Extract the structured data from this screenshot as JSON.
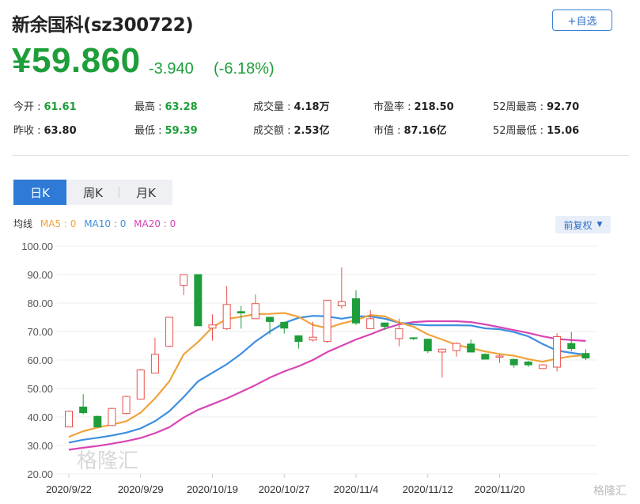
{
  "header": {
    "title": "新余国科(sz300722)",
    "watch_label": "+自选",
    "price": "¥59.860",
    "change": "-3.940",
    "change_pct": "(-6.18%)"
  },
  "stats": [
    {
      "label": "今开 :",
      "value": "61.61",
      "color": "green"
    },
    {
      "label": "最高 :",
      "value": "63.28",
      "color": "green"
    },
    {
      "label": "成交量 :",
      "value": "4.18万",
      "color": "dark"
    },
    {
      "label": "市盈率 :",
      "value": "218.50",
      "color": "dark"
    },
    {
      "label": "52周最高 :",
      "value": "92.70",
      "color": "dark"
    },
    {
      "label": "昨收 :",
      "value": "63.80",
      "color": "dark"
    },
    {
      "label": "最低 :",
      "value": "59.39",
      "color": "green"
    },
    {
      "label": "成交额 :",
      "value": "2.53亿",
      "color": "dark"
    },
    {
      "label": "市值 :",
      "value": "87.16亿",
      "color": "dark"
    },
    {
      "label": "52周最低 :",
      "value": "15.06",
      "color": "dark"
    }
  ],
  "tabs": [
    "日K",
    "周K",
    "月K"
  ],
  "ma_legend": {
    "prefix": "均线",
    "ma5": "MA5 : 0",
    "ma10": "MA10 : 0",
    "ma20": "MA20 : 0"
  },
  "adjust_label": "前复权",
  "watermark": {
    "center": "格隆汇",
    "corner": "格隆汇"
  },
  "colors": {
    "up": "#e8524d",
    "down": "#1e9e3a",
    "ma5": "#f0a33c",
    "ma10": "#3d8fe0",
    "ma20": "#d944b4",
    "accent": "#2f7ad6"
  },
  "chart_data": {
    "type": "candlestick",
    "ylim": [
      20,
      100
    ],
    "y_ticks": [
      "100.00",
      "90.00",
      "80.00",
      "70.00",
      "60.00",
      "50.00",
      "40.00",
      "30.00",
      "20.00"
    ],
    "x_tick_labels": [
      "2020/9/22",
      "2020/9/29",
      "2020/10/19",
      "2020/10/27",
      "2020/11/4",
      "2020/11/12",
      "2020/11/20"
    ],
    "x_tick_index": [
      0,
      5,
      10,
      15,
      20,
      25,
      30
    ],
    "candles": [
      {
        "o": 36.5,
        "h": 42.2,
        "l": 36.5,
        "c": 42.0
      },
      {
        "o": 43.5,
        "h": 48.0,
        "l": 41.0,
        "c": 41.5
      },
      {
        "o": 40.2,
        "h": 40.5,
        "l": 36.3,
        "c": 36.5
      },
      {
        "o": 37.0,
        "h": 43.2,
        "l": 36.8,
        "c": 43.0
      },
      {
        "o": 41.2,
        "h": 47.5,
        "l": 41.0,
        "c": 47.2
      },
      {
        "o": 46.3,
        "h": 56.8,
        "l": 46.2,
        "c": 56.5
      },
      {
        "o": 55.4,
        "h": 67.8,
        "l": 55.3,
        "c": 62.0
      },
      {
        "o": 64.8,
        "h": 75.0,
        "l": 64.5,
        "c": 75.0
      },
      {
        "o": 86.2,
        "h": 90.2,
        "l": 82.8,
        "c": 90.0
      },
      {
        "o": 90.0,
        "h": 90.0,
        "l": 72.0,
        "c": 72.0
      },
      {
        "o": 71.2,
        "h": 76.0,
        "l": 66.8,
        "c": 72.3
      },
      {
        "o": 71.0,
        "h": 86.0,
        "l": 70.5,
        "c": 79.5
      },
      {
        "o": 77.0,
        "h": 79.0,
        "l": 71.0,
        "c": 76.5
      },
      {
        "o": 74.5,
        "h": 83.0,
        "l": 74.3,
        "c": 79.8
      },
      {
        "o": 75.0,
        "h": 75.2,
        "l": 69.0,
        "c": 73.5
      },
      {
        "o": 73.2,
        "h": 73.5,
        "l": 69.3,
        "c": 71.2
      },
      {
        "o": 68.5,
        "h": 68.7,
        "l": 64.0,
        "c": 66.5
      },
      {
        "o": 67.0,
        "h": 73.5,
        "l": 66.5,
        "c": 68.0
      },
      {
        "o": 66.5,
        "h": 81.0,
        "l": 66.0,
        "c": 81.0
      },
      {
        "o": 79.0,
        "h": 92.5,
        "l": 78.0,
        "c": 80.5
      },
      {
        "o": 81.5,
        "h": 84.5,
        "l": 72.3,
        "c": 73.0
      },
      {
        "o": 71.0,
        "h": 77.5,
        "l": 70.8,
        "c": 74.5
      },
      {
        "o": 73.0,
        "h": 73.2,
        "l": 70.5,
        "c": 71.8
      },
      {
        "o": 67.5,
        "h": 74.5,
        "l": 64.8,
        "c": 71.0
      },
      {
        "o": 67.8,
        "h": 68.0,
        "l": 67.0,
        "c": 67.5
      },
      {
        "o": 67.3,
        "h": 67.5,
        "l": 62.5,
        "c": 63.2
      },
      {
        "o": 62.8,
        "h": 64.0,
        "l": 53.8,
        "c": 63.8
      },
      {
        "o": 63.3,
        "h": 66.2,
        "l": 61.2,
        "c": 65.8
      },
      {
        "o": 65.6,
        "h": 67.2,
        "l": 62.7,
        "c": 62.8
      },
      {
        "o": 62.0,
        "h": 62.3,
        "l": 60.2,
        "c": 60.3
      },
      {
        "o": 61.0,
        "h": 62.0,
        "l": 59.0,
        "c": 61.4
      },
      {
        "o": 60.2,
        "h": 60.5,
        "l": 57.3,
        "c": 58.3
      },
      {
        "o": 59.3,
        "h": 59.8,
        "l": 57.6,
        "c": 58.3
      },
      {
        "o": 57.0,
        "h": 58.6,
        "l": 56.8,
        "c": 58.3
      },
      {
        "o": 57.5,
        "h": 69.4,
        "l": 56.0,
        "c": 68.2
      },
      {
        "o": 65.8,
        "h": 69.8,
        "l": 63.0,
        "c": 64.0
      },
      {
        "o": 62.3,
        "h": 63.8,
        "l": 60.0,
        "c": 60.7
      }
    ],
    "ma5": [
      33.0,
      35.0,
      36.3,
      37.3,
      38.5,
      41.5,
      46.5,
      52.5,
      62.0,
      66.3,
      71.5,
      74.4,
      75.2,
      76.1,
      76.2,
      76.5,
      75.2,
      72.3,
      71.2,
      72.8,
      74.0,
      75.8,
      75.3,
      73.2,
      71.7,
      69.0,
      67.2,
      65.3,
      64.2,
      63.0,
      62.1,
      61.5,
      60.3,
      59.4,
      60.5,
      61.3,
      61.7
    ],
    "ma10": [
      31.0,
      32.0,
      32.7,
      33.5,
      34.5,
      36.0,
      38.5,
      42.0,
      47.0,
      52.5,
      55.5,
      58.5,
      62.2,
      66.5,
      70.0,
      73.0,
      74.8,
      75.5,
      75.3,
      74.5,
      75.3,
      75.3,
      74.5,
      73.1,
      72.5,
      72.2,
      72.2,
      72.2,
      72.1,
      71.1,
      70.8,
      69.8,
      68.3,
      65.6,
      63.3,
      62.5,
      61.8
    ],
    "ma20": [
      28.5,
      29.2,
      29.8,
      30.6,
      31.5,
      32.6,
      34.3,
      36.4,
      39.8,
      42.5,
      44.5,
      46.5,
      48.8,
      51.2,
      53.8,
      56.0,
      57.8,
      60.0,
      62.8,
      65.0,
      67.2,
      69.0,
      71.0,
      72.5,
      73.3,
      73.6,
      73.6,
      73.6,
      73.3,
      72.5,
      71.5,
      70.5,
      69.5,
      68.3,
      67.4,
      67.0,
      66.7
    ]
  }
}
